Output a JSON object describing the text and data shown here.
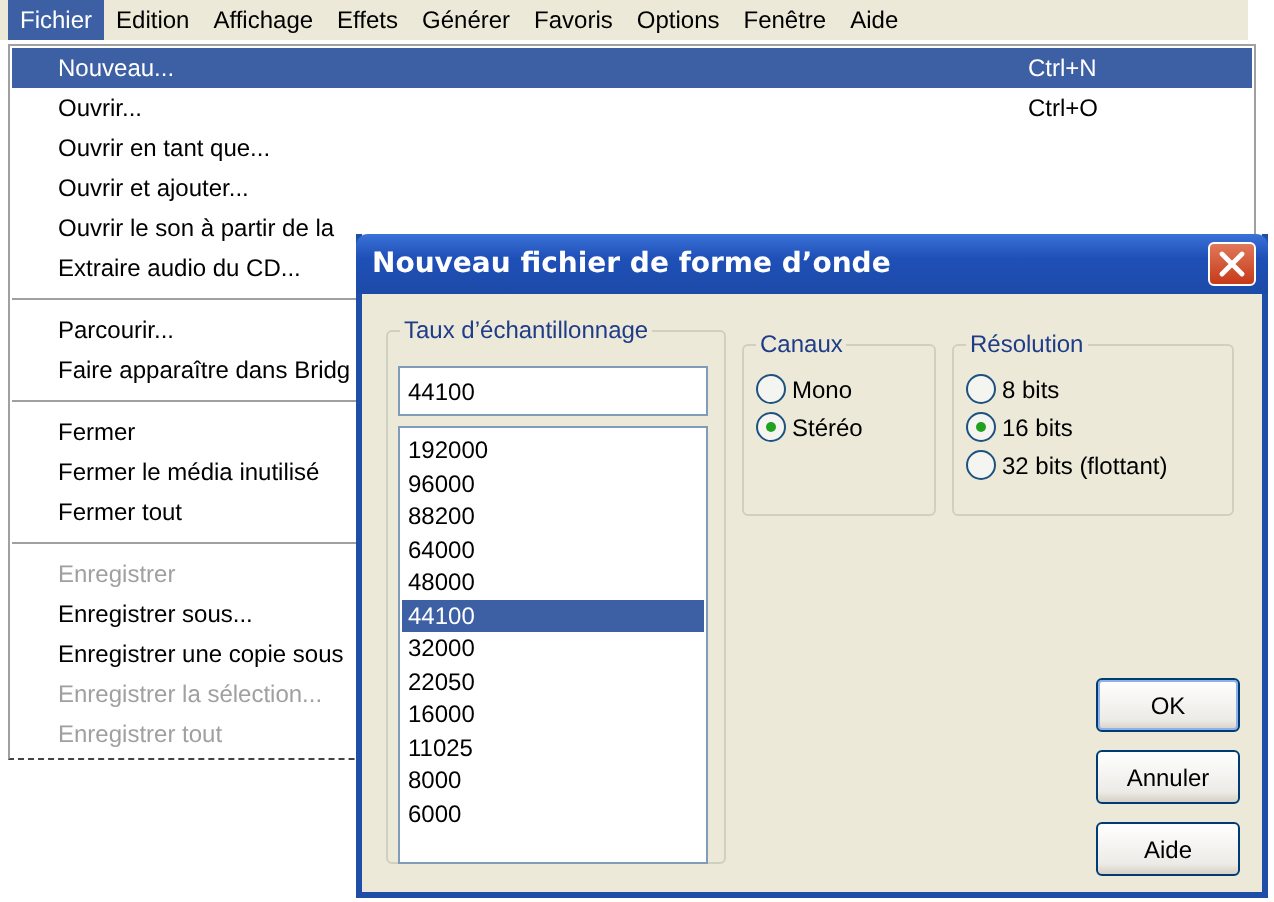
{
  "menubar": [
    {
      "label": "Fichier",
      "selected": true
    },
    {
      "label": "Edition",
      "selected": false
    },
    {
      "label": "Affichage",
      "selected": false
    },
    {
      "label": "Effets",
      "selected": false
    },
    {
      "label": "Générer",
      "selected": false
    },
    {
      "label": "Favoris",
      "selected": false
    },
    {
      "label": "Options",
      "selected": false
    },
    {
      "label": "Fenêtre",
      "selected": false
    },
    {
      "label": "Aide",
      "selected": false
    }
  ],
  "menu": {
    "items": [
      {
        "kind": "item",
        "label": "Nouveau...",
        "shortcut": "Ctrl+N",
        "selected": true,
        "disabled": false
      },
      {
        "kind": "item",
        "label": "Ouvrir...",
        "shortcut": "Ctrl+O",
        "selected": false,
        "disabled": false
      },
      {
        "kind": "item",
        "label": "Ouvrir en tant que...",
        "selected": false,
        "disabled": false
      },
      {
        "kind": "item",
        "label": "Ouvrir et ajouter...",
        "selected": false,
        "disabled": false
      },
      {
        "kind": "item",
        "label": "Ouvrir le son à partir de la",
        "selected": false,
        "disabled": false
      },
      {
        "kind": "item",
        "label": "Extraire audio du CD...",
        "selected": false,
        "disabled": false
      },
      {
        "kind": "separator"
      },
      {
        "kind": "item",
        "label": "Parcourir...",
        "selected": false,
        "disabled": false
      },
      {
        "kind": "item",
        "label": "Faire apparaître dans Bridg",
        "selected": false,
        "disabled": false
      },
      {
        "kind": "separator"
      },
      {
        "kind": "item",
        "label": "Fermer",
        "selected": false,
        "disabled": false
      },
      {
        "kind": "item",
        "label": "Fermer le média inutilisé",
        "selected": false,
        "disabled": false
      },
      {
        "kind": "item",
        "label": "Fermer tout",
        "selected": false,
        "disabled": false
      },
      {
        "kind": "separator"
      },
      {
        "kind": "item",
        "label": "Enregistrer",
        "selected": false,
        "disabled": true
      },
      {
        "kind": "item",
        "label": "Enregistrer sous...",
        "selected": false,
        "disabled": false
      },
      {
        "kind": "item",
        "label": "Enregistrer une copie sous",
        "selected": false,
        "disabled": false
      },
      {
        "kind": "item",
        "label": "Enregistrer la sélection...",
        "selected": false,
        "disabled": true
      },
      {
        "kind": "item",
        "label": "Enregistrer tout",
        "selected": false,
        "disabled": true
      }
    ]
  },
  "dialog": {
    "title": "Nouveau fichier de forme d’onde",
    "sample_rate": {
      "label": "Taux d’échantillonnage",
      "value": "44100",
      "options": [
        {
          "label": "192000",
          "selected": false
        },
        {
          "label": "96000",
          "selected": false
        },
        {
          "label": "88200",
          "selected": false
        },
        {
          "label": "64000",
          "selected": false
        },
        {
          "label": "48000",
          "selected": false
        },
        {
          "label": "44100",
          "selected": true
        },
        {
          "label": "32000",
          "selected": false
        },
        {
          "label": "22050",
          "selected": false
        },
        {
          "label": "16000",
          "selected": false
        },
        {
          "label": "11025",
          "selected": false
        },
        {
          "label": "8000",
          "selected": false
        },
        {
          "label": "6000",
          "selected": false
        }
      ]
    },
    "channels": {
      "label": "Canaux",
      "options": [
        {
          "label": "Mono",
          "selected": false
        },
        {
          "label": "Stéréo",
          "selected": true
        }
      ]
    },
    "resolution": {
      "label": "Résolution",
      "options": [
        {
          "label": "8 bits",
          "selected": false
        },
        {
          "label": "16 bits",
          "selected": true
        },
        {
          "label": "32 bits (flottant)",
          "selected": false
        }
      ]
    },
    "buttons": [
      "OK",
      "Annuler",
      "Aide"
    ]
  }
}
